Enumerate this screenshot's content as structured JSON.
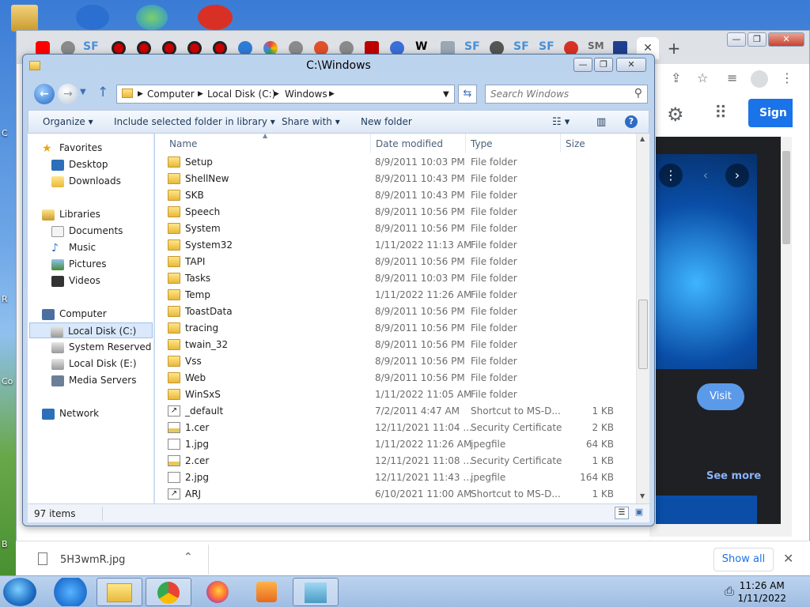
{
  "explorer": {
    "title": "C:\\Windows",
    "breadcrumb": [
      "Computer",
      "Local Disk (C:)",
      "Windows"
    ],
    "search_placeholder": "Search Windows",
    "commands": {
      "organize": "Organize",
      "include": "Include selected folder in library",
      "share": "Share with",
      "new_folder": "New folder"
    },
    "nav": {
      "favorites": "Favorites",
      "desktop": "Desktop",
      "downloads": "Downloads",
      "libraries": "Libraries",
      "documents": "Documents",
      "music": "Music",
      "pictures": "Pictures",
      "videos": "Videos",
      "computer": "Computer",
      "local_c": "Local Disk (C:)",
      "system_reserved": "System Reserved (D:",
      "local_e": "Local Disk (E:)",
      "media_servers": "Media Servers",
      "network": "Network"
    },
    "columns": {
      "name": "Name",
      "date": "Date modified",
      "type": "Type",
      "size": "Size"
    },
    "rows": [
      {
        "name": "Setup",
        "date": "8/9/2011 10:03 PM",
        "type": "File folder",
        "size": "",
        "kind": "folder"
      },
      {
        "name": "ShellNew",
        "date": "8/9/2011 10:43 PM",
        "type": "File folder",
        "size": "",
        "kind": "folder"
      },
      {
        "name": "SKB",
        "date": "8/9/2011 10:43 PM",
        "type": "File folder",
        "size": "",
        "kind": "folder"
      },
      {
        "name": "Speech",
        "date": "8/9/2011 10:56 PM",
        "type": "File folder",
        "size": "",
        "kind": "folder"
      },
      {
        "name": "System",
        "date": "8/9/2011 10:56 PM",
        "type": "File folder",
        "size": "",
        "kind": "folder"
      },
      {
        "name": "System32",
        "date": "1/11/2022 11:13 AM",
        "type": "File folder",
        "size": "",
        "kind": "folder"
      },
      {
        "name": "TAPI",
        "date": "8/9/2011 10:56 PM",
        "type": "File folder",
        "size": "",
        "kind": "folder"
      },
      {
        "name": "Tasks",
        "date": "8/9/2011 10:03 PM",
        "type": "File folder",
        "size": "",
        "kind": "folder"
      },
      {
        "name": "Temp",
        "date": "1/11/2022 11:26 AM",
        "type": "File folder",
        "size": "",
        "kind": "folder"
      },
      {
        "name": "ToastData",
        "date": "8/9/2011 10:56 PM",
        "type": "File folder",
        "size": "",
        "kind": "folder"
      },
      {
        "name": "tracing",
        "date": "8/9/2011 10:56 PM",
        "type": "File folder",
        "size": "",
        "kind": "folder"
      },
      {
        "name": "twain_32",
        "date": "8/9/2011 10:56 PM",
        "type": "File folder",
        "size": "",
        "kind": "folder"
      },
      {
        "name": "Vss",
        "date": "8/9/2011 10:56 PM",
        "type": "File folder",
        "size": "",
        "kind": "folder"
      },
      {
        "name": "Web",
        "date": "8/9/2011 10:56 PM",
        "type": "File folder",
        "size": "",
        "kind": "folder"
      },
      {
        "name": "WinSxS",
        "date": "1/11/2022 11:05 AM",
        "type": "File folder",
        "size": "",
        "kind": "folder"
      },
      {
        "name": "_default",
        "date": "7/2/2011 4:47 AM",
        "type": "Shortcut to MS-D...",
        "size": "1 KB",
        "kind": "shortcut"
      },
      {
        "name": "1.cer",
        "date": "12/11/2021 11:04 ...",
        "type": "Security Certificate",
        "size": "2 KB",
        "kind": "cert"
      },
      {
        "name": "1.jpg",
        "date": "1/11/2022 11:26 AM",
        "type": "jpegfile",
        "size": "64 KB",
        "kind": "file"
      },
      {
        "name": "2.cer",
        "date": "12/11/2021 11:08 ...",
        "type": "Security Certificate",
        "size": "1 KB",
        "kind": "cert"
      },
      {
        "name": "2.jpg",
        "date": "12/11/2021 11:43 ...",
        "type": "jpegfile",
        "size": "164 KB",
        "kind": "file"
      },
      {
        "name": "ARJ",
        "date": "6/10/2021 11:00 AM",
        "type": "Shortcut to MS-D...",
        "size": "1 KB",
        "kind": "shortcut"
      }
    ],
    "status": "97 items"
  },
  "chrome": {
    "sign_in": "Sign i",
    "visit": "Visit",
    "see_more": "See more",
    "tab_sf": "SF",
    "tab_w": "W",
    "tab_sm": "SM"
  },
  "download_bar": {
    "file": "5H3wmR.jpg",
    "show_all": "Show all"
  },
  "taskbar": {
    "time": "11:26 AM",
    "date": "1/11/2022"
  },
  "desktop": {
    "labels": [
      "C",
      "R",
      "Co",
      "B"
    ]
  },
  "colors": {
    "accent": "#1a73e8",
    "folder": "#e8b93a",
    "selection": "#d9e8fb"
  }
}
